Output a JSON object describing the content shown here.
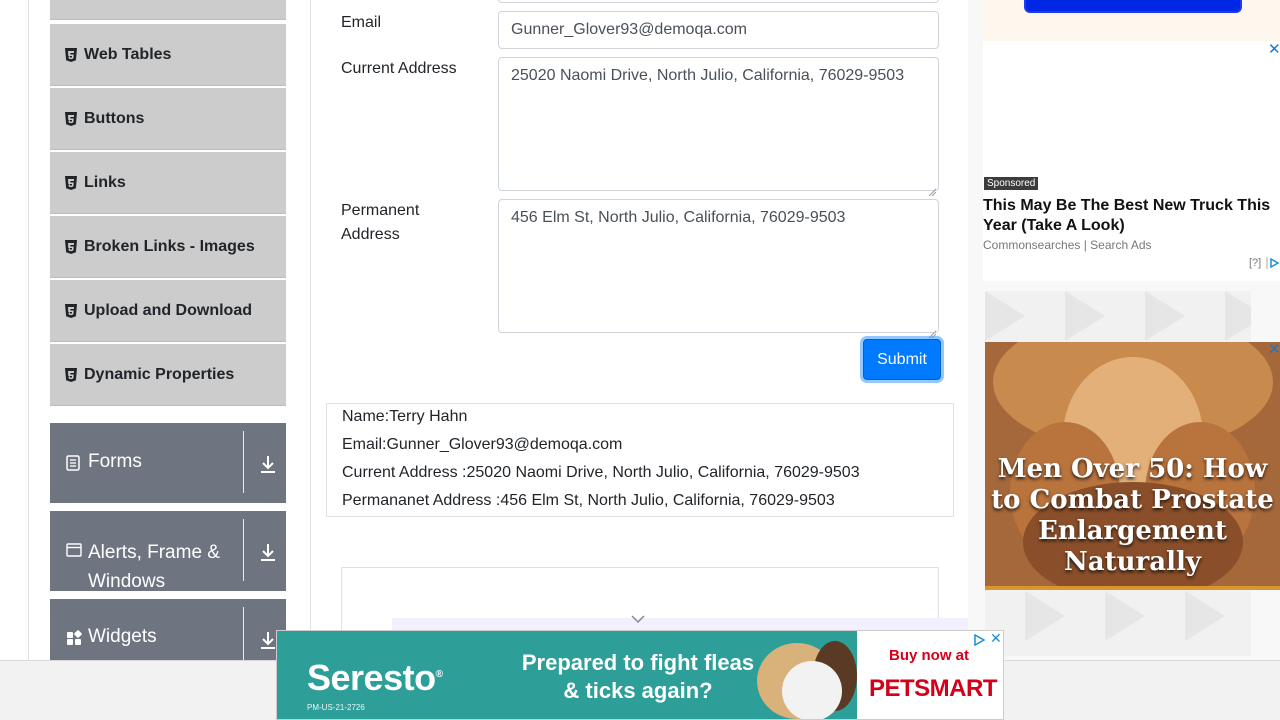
{
  "sidebar": {
    "items": [
      {
        "label": "Web Tables"
      },
      {
        "label": "Buttons"
      },
      {
        "label": "Links"
      },
      {
        "label": "Broken Links - Images"
      },
      {
        "label": "Upload and Download"
      },
      {
        "label": "Dynamic Properties"
      }
    ],
    "groups": [
      {
        "label": "Forms",
        "icon": "form-icon"
      },
      {
        "label": "Alerts, Frame &\nWindows",
        "label_line1": "Alerts, Frame &",
        "label_line2": "Windows",
        "icon": "window-icon"
      },
      {
        "label": "Widgets",
        "icon": "widgets-icon"
      }
    ]
  },
  "form": {
    "email_label": "Email",
    "email_value": "Gunner_Glover93@demoqa.com",
    "current_address_label": "Current Address",
    "current_address_value": "25020 Naomi Drive, North Julio, California, 76029-9503",
    "permanent_address_label_line1": "Permanent",
    "permanent_address_label_line2": "Address",
    "permanent_address_value": "456 Elm St, North Julio, California, 76029-9503",
    "submit_label": "Submit"
  },
  "output": {
    "name": "Name:Terry Hahn",
    "email": "Email:Gunner_Glover93@demoqa.com",
    "current_address": "Current Address :25020 Naomi Drive, North Julio, California, 76029-9503",
    "permanent_address": "Permananet Address :456 Elm St, North Julio, California, 76029-9503"
  },
  "ads": {
    "sponsored_label": "Sponsored",
    "card_title": "This May Be The Best New Truck This Year (Take A Look)",
    "card_source": "Commonsearches | Search Ads",
    "card_help": "[?]",
    "medical_headline": "Men Over 50: How to Combat Prostate Enlargement Naturally",
    "banner_brand": "Seresto",
    "banner_code": "PM-US-21-2726",
    "banner_tagline": "Prepared to fight fleas & ticks again?",
    "banner_buy": "Buy now at",
    "banner_store": "PETSMART"
  },
  "colors": {
    "sidebar_item_bg": "#cccccc",
    "group_bg": "#6e7580",
    "submit_bg": "#007bff",
    "banner_bg": "#2d9f98",
    "petsmart_red": "#d4001a"
  }
}
